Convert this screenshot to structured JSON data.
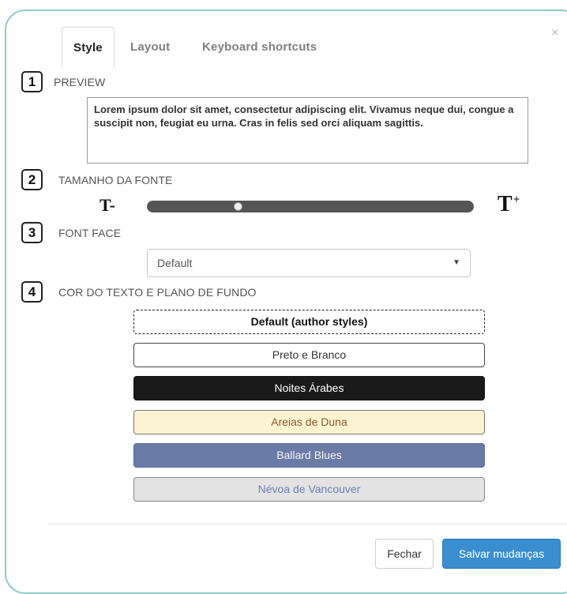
{
  "tabs": [
    {
      "label": "Style",
      "active": true
    },
    {
      "label": "Layout",
      "active": false
    },
    {
      "label": "Keyboard shortcuts",
      "active": false
    }
  ],
  "close_glyph": "×",
  "sections": {
    "preview": {
      "number": "1",
      "label": "PREVIEW",
      "text": "Lorem ipsum dolor sit amet, consectetur adipiscing elit. Vivamus neque dui, congue a suscipit non, feugiat eu urna. Cras in felis sed orci aliquam sagittis."
    },
    "font_size": {
      "number": "2",
      "label": "TAMANHO DA FONTE",
      "smaller_label": "T-",
      "larger_label": "T",
      "larger_sup": "+",
      "slider_value_fraction": 0.27
    },
    "font_face": {
      "number": "3",
      "label": "FONT FACE",
      "selected": "Default",
      "caret": "▼"
    },
    "colors": {
      "number": "4",
      "label": "COR DO TEXTO E PLANO DE FUNDO",
      "themes": [
        {
          "label": "Default (author styles)",
          "selected": true
        },
        {
          "label": "Preto e Branco",
          "bg": "#ffffff",
          "fg": "#333333"
        },
        {
          "label": "Noites Árabes",
          "bg": "#1a1a1a",
          "fg": "#ffffff"
        },
        {
          "label": "Areias de Duna",
          "bg": "#fcf3d2",
          "fg": "#8a5a2b"
        },
        {
          "label": "Ballard Blues",
          "bg": "#6a7ba6",
          "fg": "#f4f4f4"
        },
        {
          "label": "Névoa de Vancouver",
          "bg": "#e3e3e3",
          "fg": "#6b80b4"
        }
      ]
    }
  },
  "footer": {
    "close_label": "Fechar",
    "save_label": "Salvar mudanças",
    "save_color": "#3a8ed0"
  }
}
